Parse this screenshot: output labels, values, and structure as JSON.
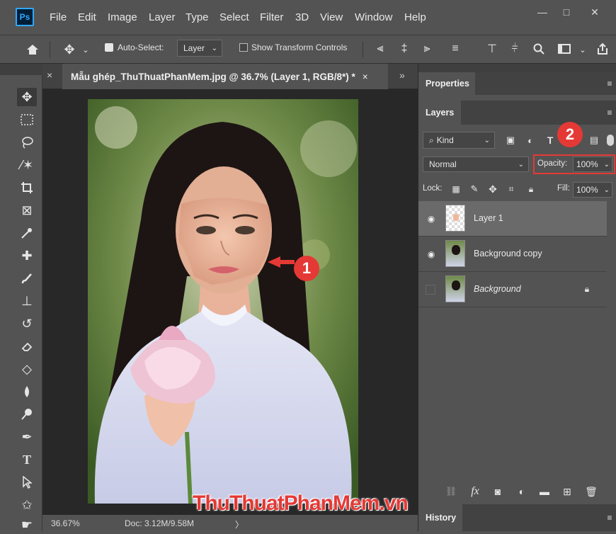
{
  "app": {
    "logo": "Ps"
  },
  "menu": [
    "File",
    "Edit",
    "Image",
    "Layer",
    "Type",
    "Select",
    "Filter",
    "3D",
    "View",
    "Window",
    "Help"
  ],
  "window_controls": {
    "minimize": "—",
    "maximize": "□",
    "close": "✕"
  },
  "options": {
    "auto_select_label": "Auto-Select:",
    "auto_select_value": "Layer",
    "show_transform_label": "Show Transform Controls"
  },
  "document": {
    "tab_title": "Mẫu ghép_ThuThuatPhanMem.jpg @ 36.7% (Layer 1, RGB/8*) *",
    "close": "×",
    "collapse": "»"
  },
  "status": {
    "zoom": "36.67%",
    "doc": "Doc: 3.12M/9.58M",
    "arrow": "〉"
  },
  "panels": {
    "properties_tab": "Properties",
    "layers_tab": "Layers",
    "filter_kind": "Kind",
    "blend_mode": "Normal",
    "opacity_label": "Opacity:",
    "opacity_value": "100%",
    "lock_label": "Lock:",
    "fill_label": "Fill:",
    "fill_value": "100%",
    "history_tab": "History"
  },
  "layers": [
    {
      "name": "Layer 1",
      "visible": true,
      "selected": true,
      "locked": false
    },
    {
      "name": "Background copy",
      "visible": true,
      "selected": false,
      "locked": false
    },
    {
      "name": "Background",
      "visible": false,
      "selected": false,
      "locked": true,
      "italic": true
    }
  ],
  "annotations": {
    "badge1": "1",
    "badge2": "2"
  },
  "watermark": "ThuThuatPhanMem.vn",
  "colors": {
    "accent": "#31a8ff",
    "badge": "#e53935",
    "highlight_box": "#e53935"
  }
}
